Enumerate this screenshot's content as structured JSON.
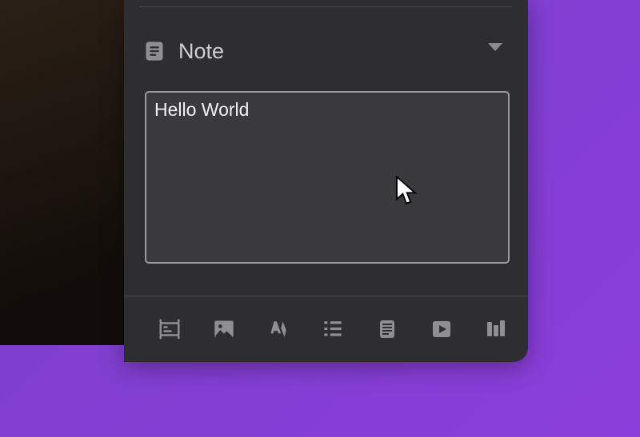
{
  "section": {
    "title": "Note"
  },
  "note": {
    "value": "Hello World"
  },
  "toolbar": {
    "items": [
      "card-icon",
      "image-icon",
      "style-icon",
      "list-icon",
      "document-icon",
      "video-icon",
      "columns-icon"
    ]
  }
}
